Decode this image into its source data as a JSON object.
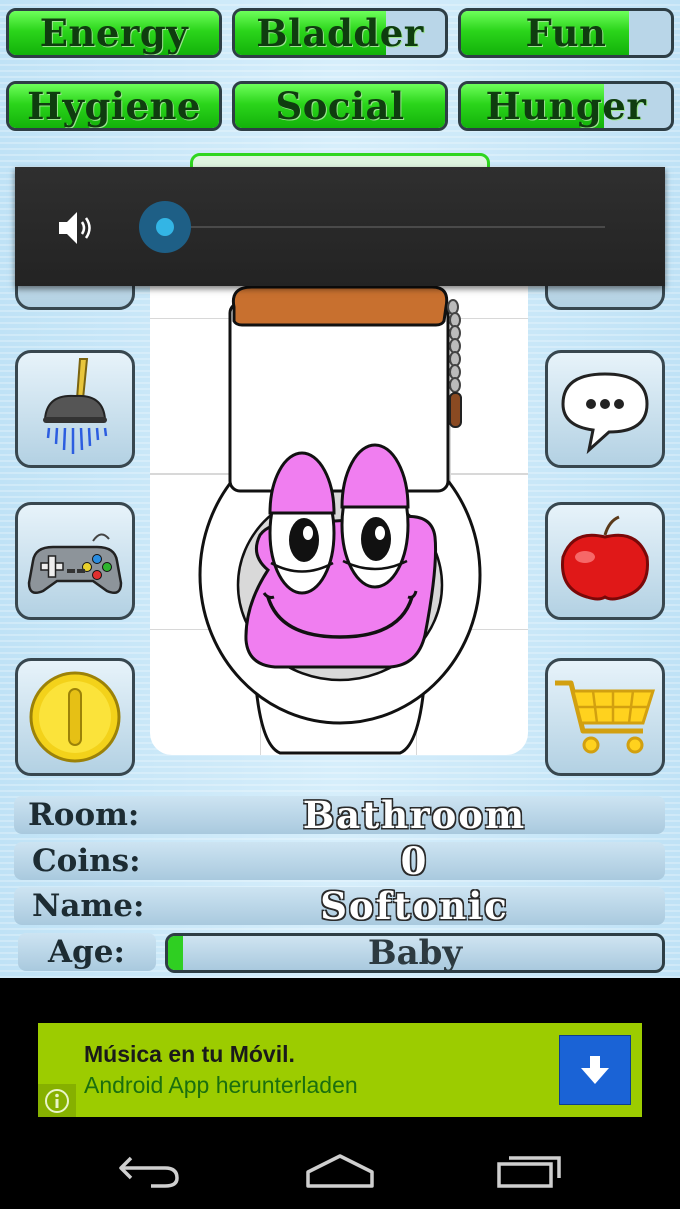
{
  "stats": [
    {
      "label": "Energy",
      "fill": 1.0
    },
    {
      "label": "Bladder",
      "fill": 0.72
    },
    {
      "label": "Fun",
      "fill": 0.8
    },
    {
      "label": "Hygiene",
      "fill": 1.0
    },
    {
      "label": "Social",
      "fill": 1.0
    },
    {
      "label": "Hunger",
      "fill": 0.68
    }
  ],
  "side_buttons": {
    "left": [
      "shower-icon",
      "gamepad-icon",
      "coin-icon"
    ],
    "right": [
      "speech-bubble-icon",
      "apple-icon",
      "shopping-cart-icon"
    ]
  },
  "info": {
    "room_label": "Room:",
    "room_value": "Bathroom",
    "coins_label": "Coins:",
    "coins_value": "0",
    "name_label": "Name:",
    "name_value": "Softonic",
    "age_label": "Age:",
    "age_value": "Baby",
    "age_progress": 0.03
  },
  "volume": {
    "level": 0.0
  },
  "ad": {
    "title": "Música en tu Móvil.",
    "subtitle": "Android App herunterladen"
  },
  "colors": {
    "stat_fill": "#2bd51b",
    "ad_background": "#9ccc00",
    "download_button": "#1a63d6",
    "character_face": "#f07ef0"
  }
}
